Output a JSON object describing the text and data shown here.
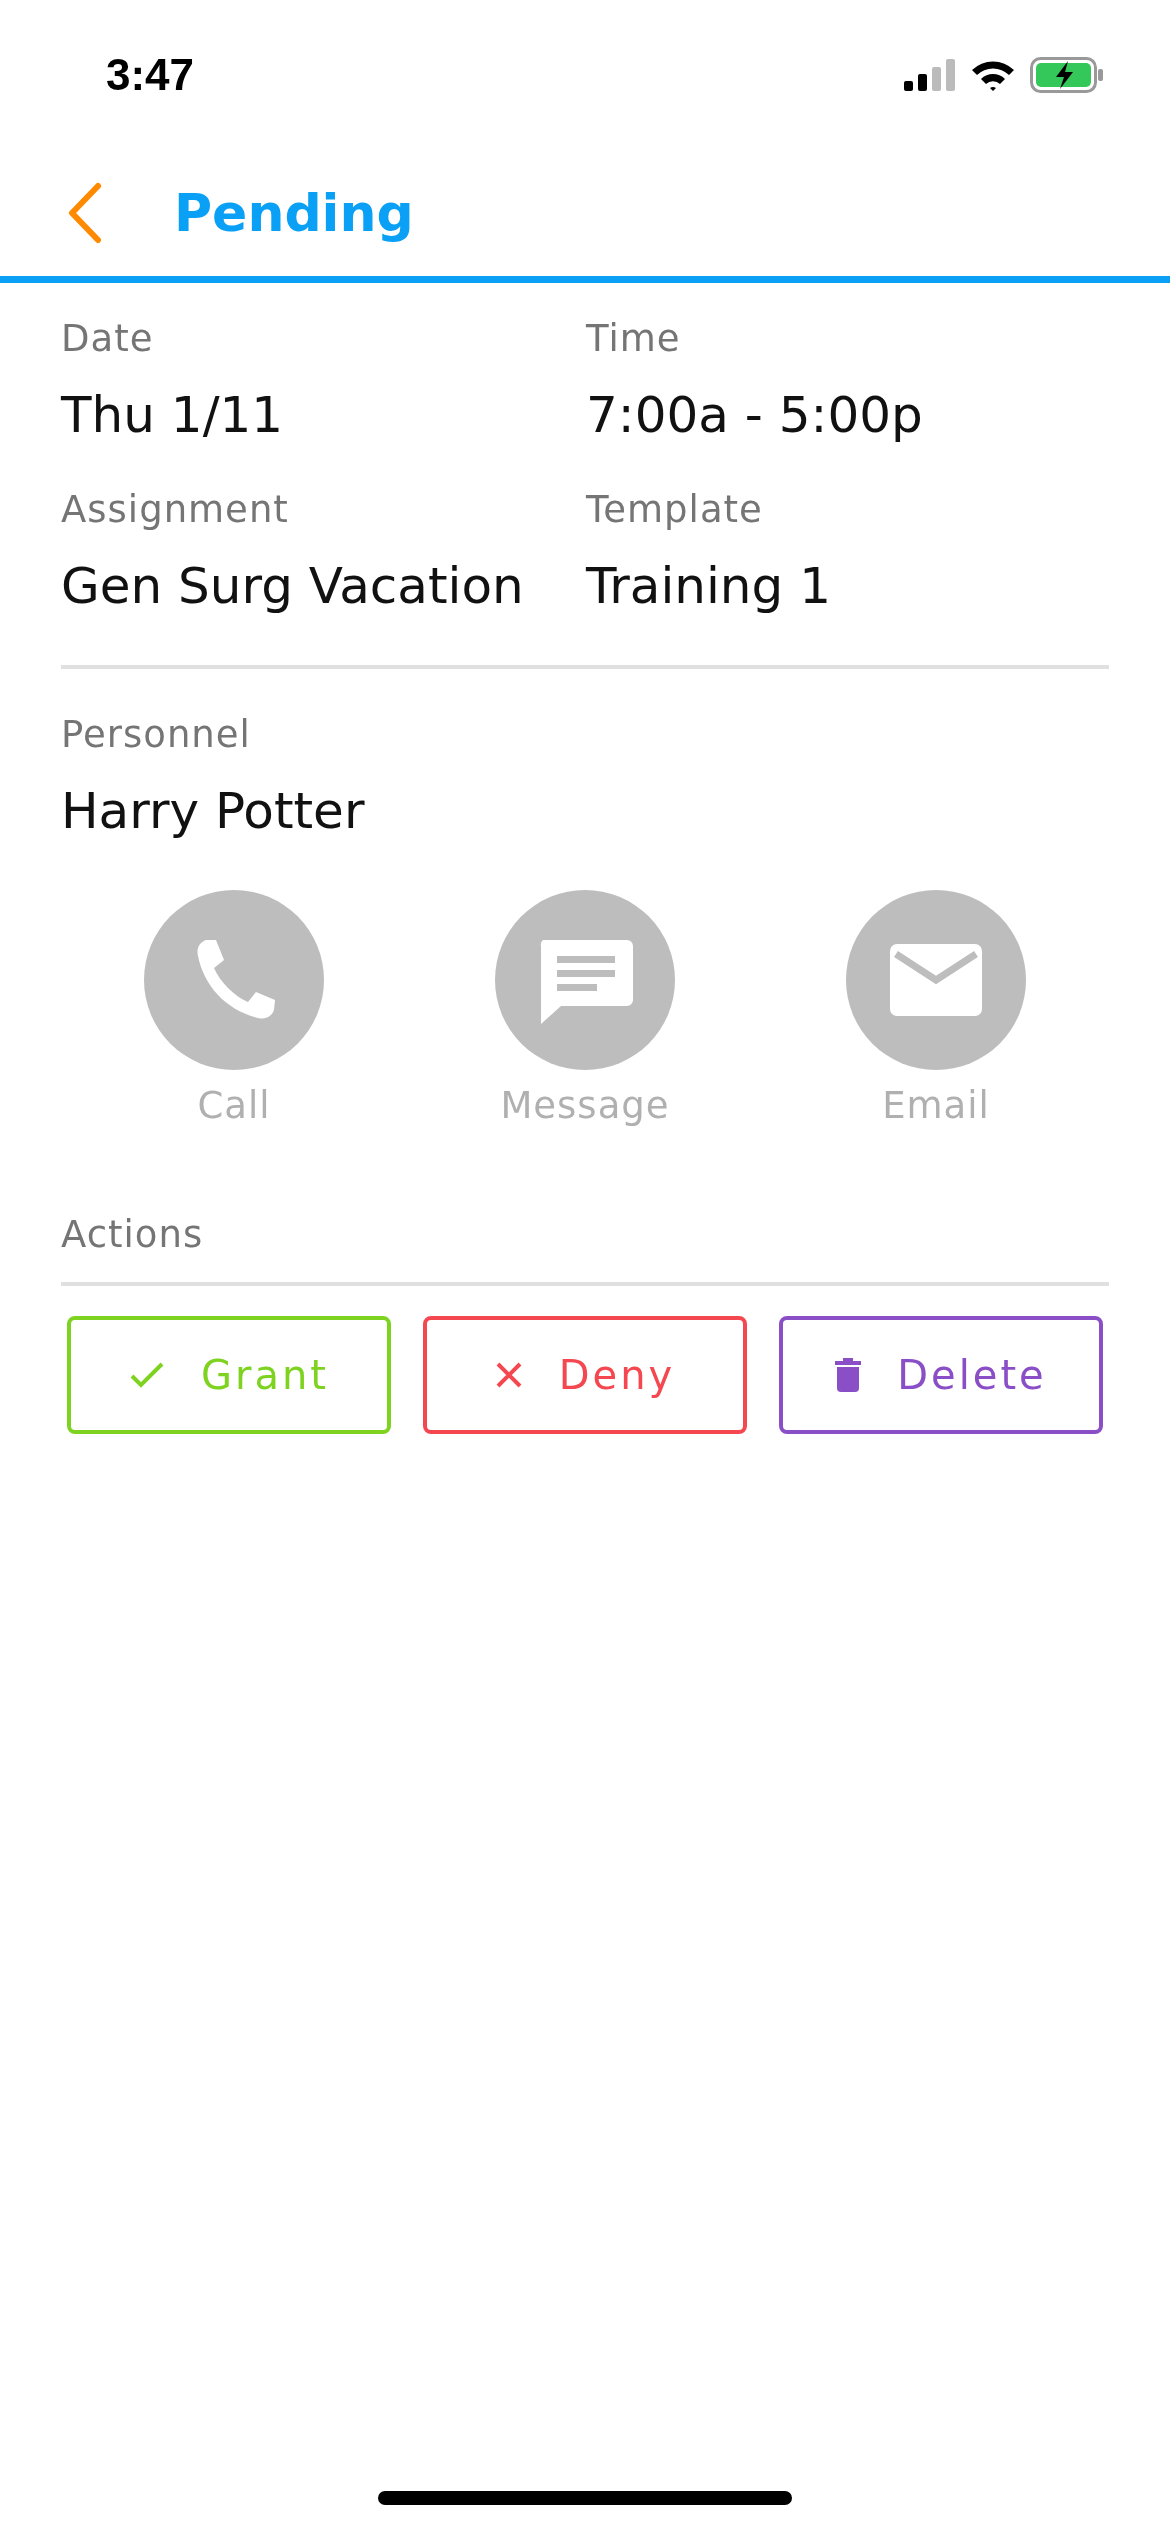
{
  "status_bar": {
    "time": "3:47"
  },
  "header": {
    "title": "Pending"
  },
  "details": [
    {
      "label": "Date",
      "value": "Thu 1/11"
    },
    {
      "label": "Time",
      "value": "7:00a - 5:00p"
    },
    {
      "label": "Assignment",
      "value": "Gen Surg Vacation"
    },
    {
      "label": "Template",
      "value": "Training 1"
    }
  ],
  "personnel": {
    "label": "Personnel",
    "name": "Harry Potter"
  },
  "contacts": [
    {
      "kind": "call",
      "label": "Call"
    },
    {
      "kind": "message",
      "label": "Message"
    },
    {
      "kind": "email",
      "label": "Email"
    }
  ],
  "actions": {
    "title": "Actions",
    "buttons": [
      {
        "kind": "grant",
        "label": "Grant",
        "color": "#7ed321"
      },
      {
        "kind": "deny",
        "label": "Deny",
        "color": "#f5474f"
      },
      {
        "kind": "delete",
        "label": "Delete",
        "color": "#8a4fc7"
      }
    ]
  }
}
